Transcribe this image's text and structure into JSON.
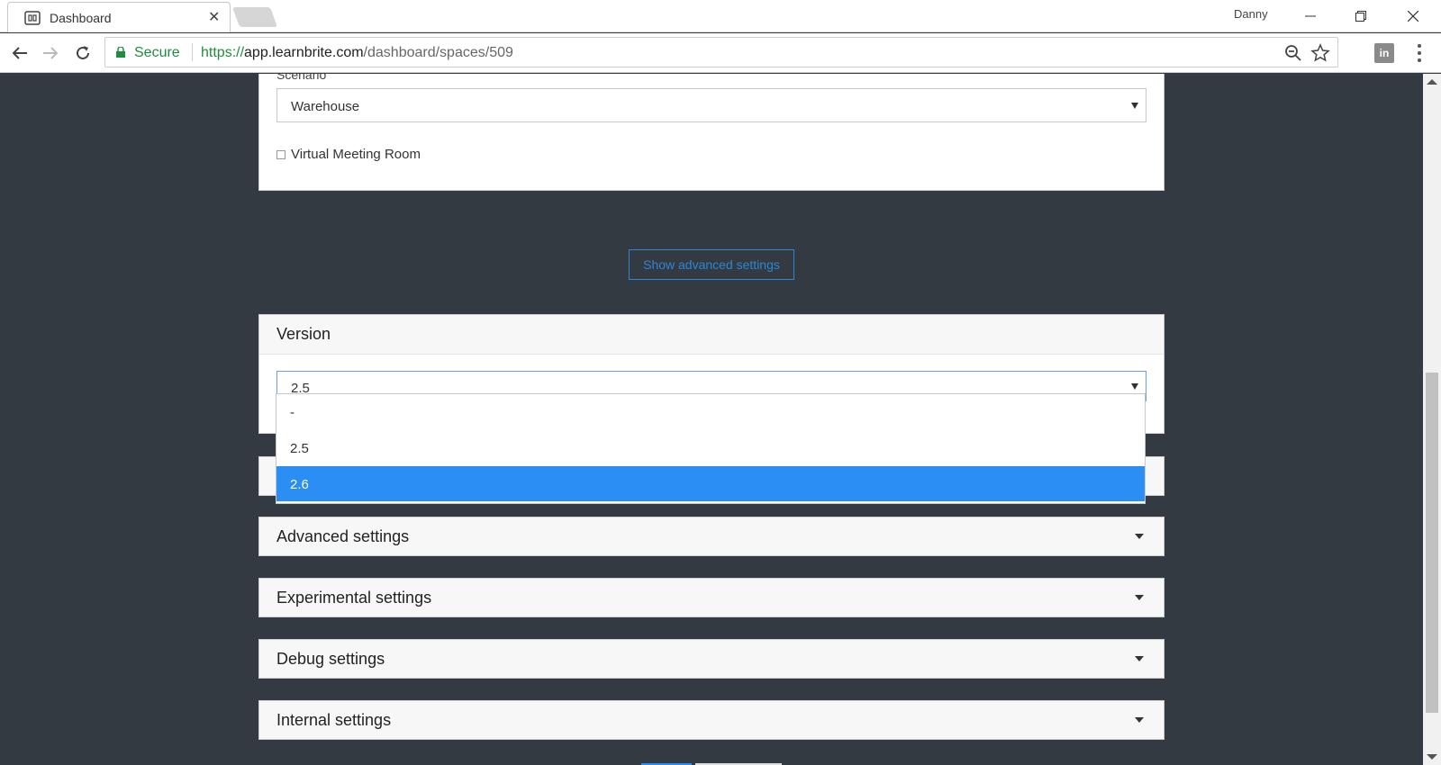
{
  "browser": {
    "tab_title": "Dashboard",
    "profile_name": "Danny",
    "secure_label": "Secure",
    "url_scheme": "https://",
    "url_host": "app.learnbrite.com",
    "url_path": "/dashboard/spaces/509",
    "extension_label": "in"
  },
  "scenario": {
    "label": "Scenario",
    "value": "Warehouse",
    "checkbox_label": "Virtual Meeting Room",
    "checkbox_checked": false
  },
  "advanced_button": "Show advanced settings",
  "version": {
    "title": "Version",
    "selected": "2.5",
    "options": [
      {
        "label": "-"
      },
      {
        "label": "2.5"
      },
      {
        "label": "2.6"
      }
    ],
    "highlighted_option": "2.6"
  },
  "sections": [
    {
      "title": "Advanced settings"
    },
    {
      "title": "Experimental settings"
    },
    {
      "title": "Debug settings"
    },
    {
      "title": "Internal settings"
    }
  ],
  "colors": {
    "accent": "#2b8ef5",
    "page_background": "#343a42",
    "secure_green": "#1e8e3e"
  }
}
